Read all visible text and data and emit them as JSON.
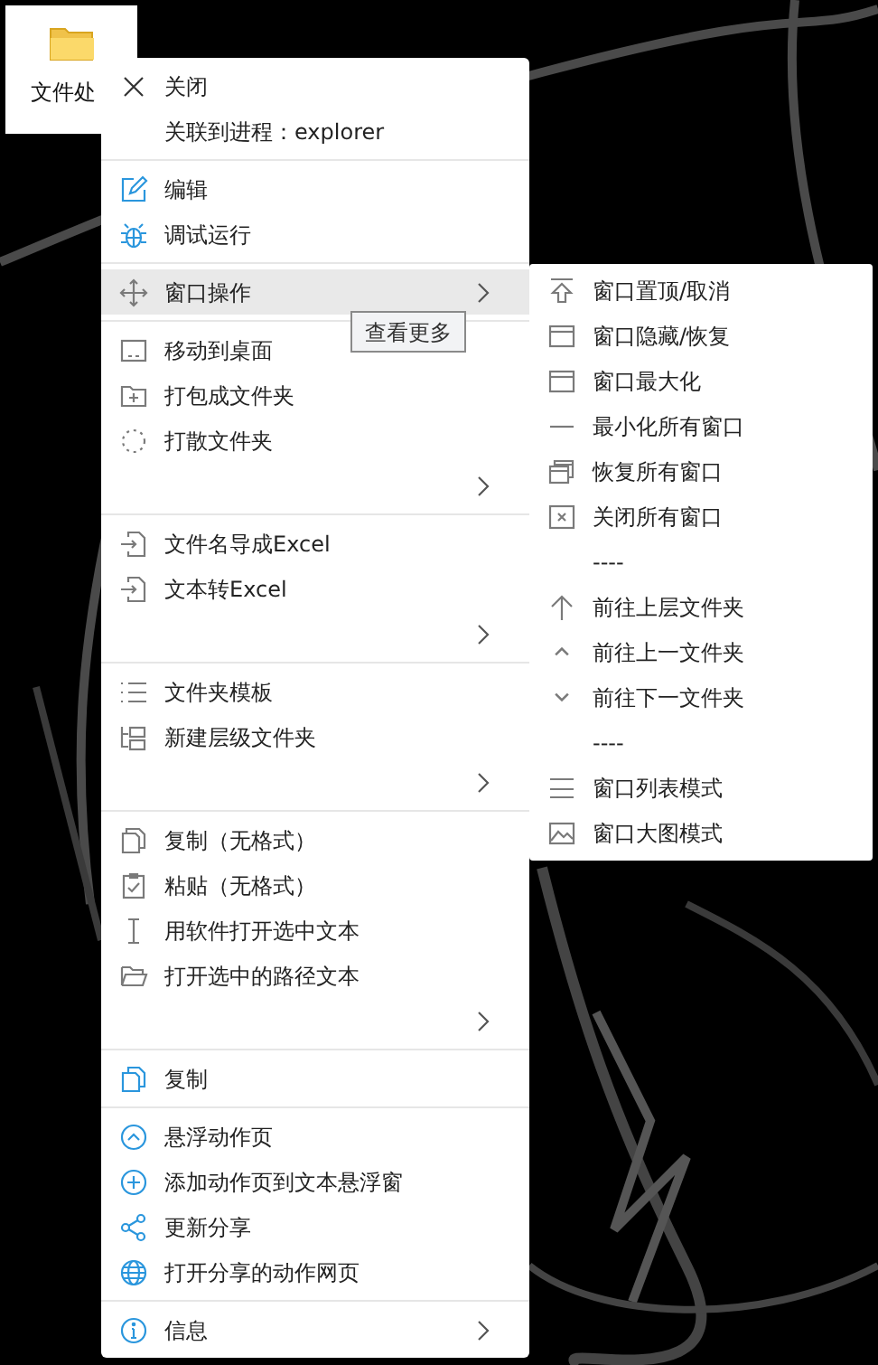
{
  "desktop_icon": {
    "label": "文件处"
  },
  "context_menu": {
    "sections": [
      [
        {
          "label": "关闭",
          "submenu": false,
          "selected": false
        },
        {
          "label": "关联到进程：explorer",
          "submenu": false,
          "selected": false
        }
      ],
      [
        {
          "label": "编辑",
          "submenu": false,
          "selected": false
        },
        {
          "label": "调试运行",
          "submenu": false,
          "selected": false
        }
      ],
      [
        {
          "label": "窗口操作",
          "submenu": true,
          "selected": true
        }
      ],
      [
        {
          "label": "移动到桌面",
          "submenu": false,
          "selected": false
        },
        {
          "label": "打包成文件夹",
          "submenu": false,
          "selected": false
        },
        {
          "label": "打散文件夹",
          "submenu": false,
          "selected": false
        },
        {
          "submenu": true,
          "selected": false
        }
      ],
      [
        {
          "label": "文件名导成Excel",
          "submenu": false,
          "selected": false
        },
        {
          "label": "文本转Excel",
          "submenu": false,
          "selected": false
        },
        {
          "submenu": true,
          "selected": false
        }
      ],
      [
        {
          "label": "文件夹模板",
          "submenu": false,
          "selected": false
        },
        {
          "label": "新建层级文件夹",
          "submenu": false,
          "selected": false
        },
        {
          "submenu": true,
          "selected": false
        }
      ],
      [
        {
          "label": "复制（无格式）",
          "submenu": false,
          "selected": false
        },
        {
          "label": "粘贴（无格式）",
          "submenu": false,
          "selected": false
        },
        {
          "label": "用软件打开选中文本",
          "submenu": false,
          "selected": false
        },
        {
          "label": "打开选中的路径文本",
          "submenu": false,
          "selected": false
        },
        {
          "submenu": true,
          "selected": false
        }
      ],
      [
        {
          "label": "复制",
          "submenu": false,
          "selected": false
        }
      ],
      [
        {
          "label": "悬浮动作页",
          "submenu": false,
          "selected": false
        },
        {
          "label": "添加动作页到文本悬浮窗",
          "submenu": false,
          "selected": false
        },
        {
          "label": "更新分享",
          "submenu": false,
          "selected": false
        },
        {
          "label": "打开分享的动作网页",
          "submenu": false,
          "selected": false
        }
      ],
      [
        {
          "label": "信息",
          "submenu": true,
          "selected": false
        }
      ]
    ]
  },
  "tooltip": {
    "text": "查看更多"
  },
  "submenu": {
    "items": [
      {
        "label": "窗口置顶/取消"
      },
      {
        "label": "窗口隐藏/恢复"
      },
      {
        "label": "窗口最大化"
      },
      {
        "label": "最小化所有窗口"
      },
      {
        "label": "恢复所有窗口"
      },
      {
        "label": "关闭所有窗口"
      },
      {
        "label": "----"
      },
      {
        "label": "前往上层文件夹"
      },
      {
        "label": "前往上一文件夹"
      },
      {
        "label": "前往下一文件夹"
      },
      {
        "label": "----"
      },
      {
        "label": "窗口列表模式"
      },
      {
        "label": "窗口大图模式"
      }
    ]
  }
}
